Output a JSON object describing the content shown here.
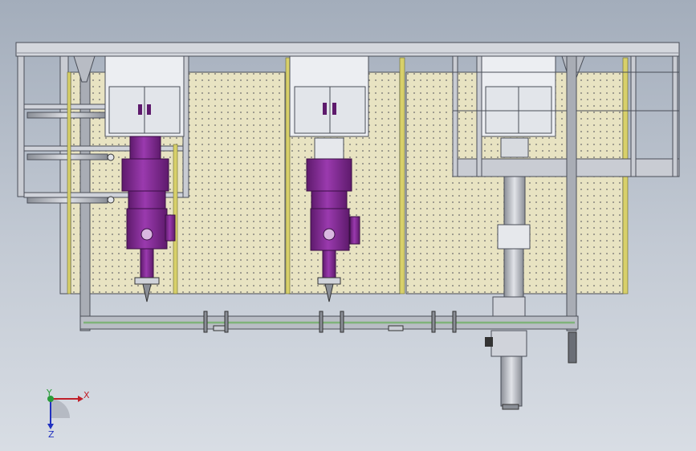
{
  "viewport": {
    "background_top": "#a3adbb",
    "background_bottom": "#d8dde4"
  },
  "colors": {
    "frame": "#c9ccd3",
    "frame_outline": "#4a4e58",
    "mesh_panel": "#e8e3c2",
    "mesh_dot": "#6a6a6a",
    "yellow_post": "#d8d06a",
    "tool_purple": "#8a2b9c",
    "tool_purple_dark": "#5e1a6c",
    "cabinet": "#eceef2",
    "rail_green": "#7fb37a",
    "gantry_gray": "#a9adb5"
  },
  "triad": {
    "x_label": "X",
    "y_label": "Y",
    "z_label": "Z",
    "x_color": "#c0202a",
    "y_color": "#2a9c3a",
    "z_color": "#2030c0"
  },
  "scene": {
    "icons": [
      "cabinet-icon",
      "spindle-icon",
      "cylinder-icon",
      "gantry-icon",
      "axis-triad-icon"
    ]
  }
}
